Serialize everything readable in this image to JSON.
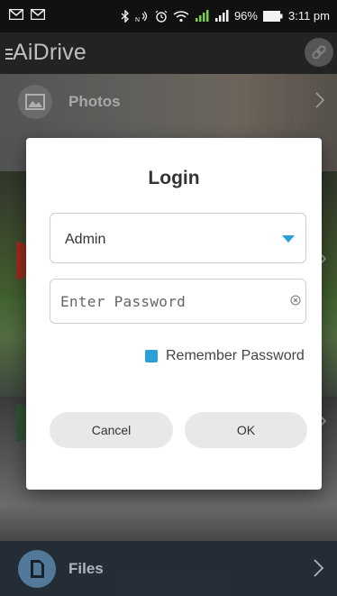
{
  "status_bar": {
    "battery_percent": "96%",
    "time": "3:11 pm",
    "icons": [
      "email-icon",
      "email-icon",
      "bluetooth-icon",
      "nfc-icon",
      "alarm-icon",
      "wifi-icon",
      "signal-icon",
      "signal-icon",
      "battery-icon"
    ]
  },
  "app_bar": {
    "title": "AiDrive",
    "menu_icon": "menu-icon",
    "link_icon": "link-icon"
  },
  "background": {
    "photos_label": "Photos",
    "files_label": "Files"
  },
  "login_dialog": {
    "title": "Login",
    "user_select_value": "Admin",
    "password_placeholder": "Enter Password",
    "remember_label": "Remember Password",
    "remember_checked": true,
    "cancel_label": "Cancel",
    "ok_label": "OK"
  },
  "colors": {
    "accent": "#2a9fd8",
    "dialog_bg": "#ffffff",
    "button_bg": "#e8e8e8"
  }
}
